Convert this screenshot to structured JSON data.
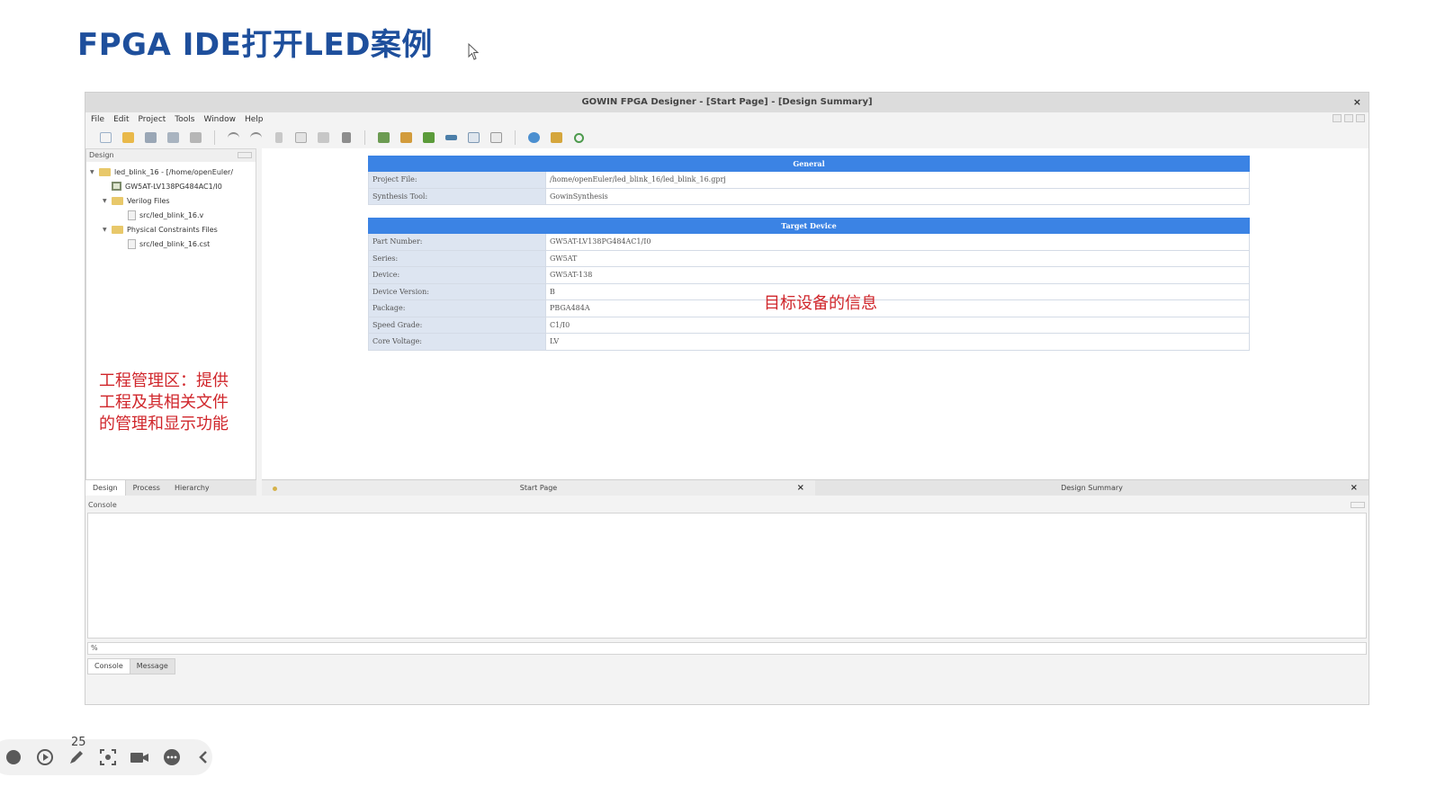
{
  "slide": {
    "title": "FPGA IDE打开LED案例",
    "page_number": "25"
  },
  "window": {
    "title": "GOWIN FPGA Designer - [Start Page] - [Design Summary]",
    "close_label": "×"
  },
  "menu": [
    "File",
    "Edit",
    "Project",
    "Tools",
    "Window",
    "Help"
  ],
  "toolbar": {
    "icons": [
      "new-file-icon",
      "open-folder-icon",
      "save-icon",
      "save-all-icon",
      "print-icon",
      "undo-icon",
      "redo-icon",
      "cut-icon",
      "copy-icon",
      "paste-icon",
      "find-icon",
      "synthesize-icon",
      "place-route-icon",
      "program-icon",
      "timing-icon",
      "report-icon",
      "schematic-icon",
      "chat-icon",
      "grid-icon",
      "refresh-icon"
    ]
  },
  "design_panel": {
    "header": "Design",
    "tree": {
      "project": "led_blink_16 - [/home/openEuler/",
      "device": "GW5AT-LV138PG484AC1/I0",
      "verilog_folder": "Verilog Files",
      "verilog_file": "src/led_blink_16.v",
      "constraints_folder": "Physical Constraints Files",
      "constraints_file": "src/led_blink_16.cst"
    },
    "tabs": [
      "Design",
      "Process",
      "Hierarchy"
    ]
  },
  "annotations": {
    "left": "工程管理区：提供工程及其相关文件的管理和显示功能",
    "center": "目标设备的信息"
  },
  "summary": {
    "general": {
      "header": "General",
      "rows": [
        {
          "key": "Project File:",
          "value": "/home/openEuler/led_blink_16/led_blink_16.gprj"
        },
        {
          "key": "Synthesis Tool:",
          "value": "GowinSynthesis"
        }
      ]
    },
    "target": {
      "header": "Target Device",
      "rows": [
        {
          "key": "Part Number:",
          "value": "GW5AT-LV138PG484AC1/I0"
        },
        {
          "key": "Series:",
          "value": "GW5AT"
        },
        {
          "key": "Device:",
          "value": "GW5AT-138"
        },
        {
          "key": "Device Version:",
          "value": "B"
        },
        {
          "key": "Package:",
          "value": "PBGA484A"
        },
        {
          "key": "Speed Grade:",
          "value": "C1/I0"
        },
        {
          "key": "Core Voltage:",
          "value": "LV"
        }
      ]
    }
  },
  "doc_tabs": [
    {
      "label": "Start Page",
      "close": "×"
    },
    {
      "label": "Design Summary",
      "close": "×"
    }
  ],
  "console": {
    "header": "Console",
    "prompt": "%",
    "tabs": [
      "Console",
      "Message"
    ]
  },
  "colors": {
    "title_blue": "#1e4f9c",
    "section_blue": "#3b83e4",
    "annotation_red": "#d0262b"
  }
}
